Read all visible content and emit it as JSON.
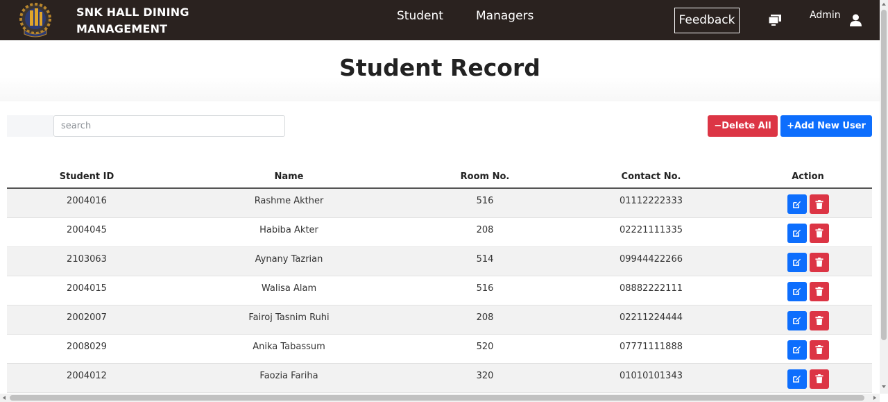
{
  "navbar": {
    "brand_line1": "SNK HALL DINING",
    "brand_line2": "MANAGEMENT",
    "links": [
      {
        "label": "Student"
      },
      {
        "label": "Managers"
      }
    ],
    "feedback_label": "Feedback",
    "admin_label": "Admin",
    "icons": [
      "logo",
      "monitor-icon",
      "user-icon"
    ],
    "bg_color": "#2a221f"
  },
  "page": {
    "title": "Student Record"
  },
  "toolbar": {
    "search_placeholder": "search",
    "search_value": "",
    "delete_all_label": "Delete All",
    "add_new_label": "Add New User",
    "delete_color": "#dc3545",
    "add_color": "#0d6efd"
  },
  "table": {
    "headers": [
      "Student ID",
      "Name",
      "Room No.",
      "Contact No.",
      "Action"
    ],
    "rows": [
      {
        "id": "2004016",
        "name": "Rashme Akther",
        "room": "516",
        "contact": "01112222333"
      },
      {
        "id": "2004045",
        "name": "Habiba Akter",
        "room": "208",
        "contact": "02221111335"
      },
      {
        "id": "2103063",
        "name": "Aynany Tazrian",
        "room": "514",
        "contact": "09944422266"
      },
      {
        "id": "2004015",
        "name": "Walisa Alam",
        "room": "516",
        "contact": "08882222111"
      },
      {
        "id": "2002007",
        "name": "Fairoj Tasnim Ruhi",
        "room": "208",
        "contact": "02211224444"
      },
      {
        "id": "2008029",
        "name": "Anika Tabassum",
        "room": "520",
        "contact": "07771111888"
      },
      {
        "id": "2004012",
        "name": "Faozia Fariha",
        "room": "320",
        "contact": "01010101343"
      }
    ],
    "action_icons": [
      "edit-icon",
      "trash-icon"
    ]
  }
}
